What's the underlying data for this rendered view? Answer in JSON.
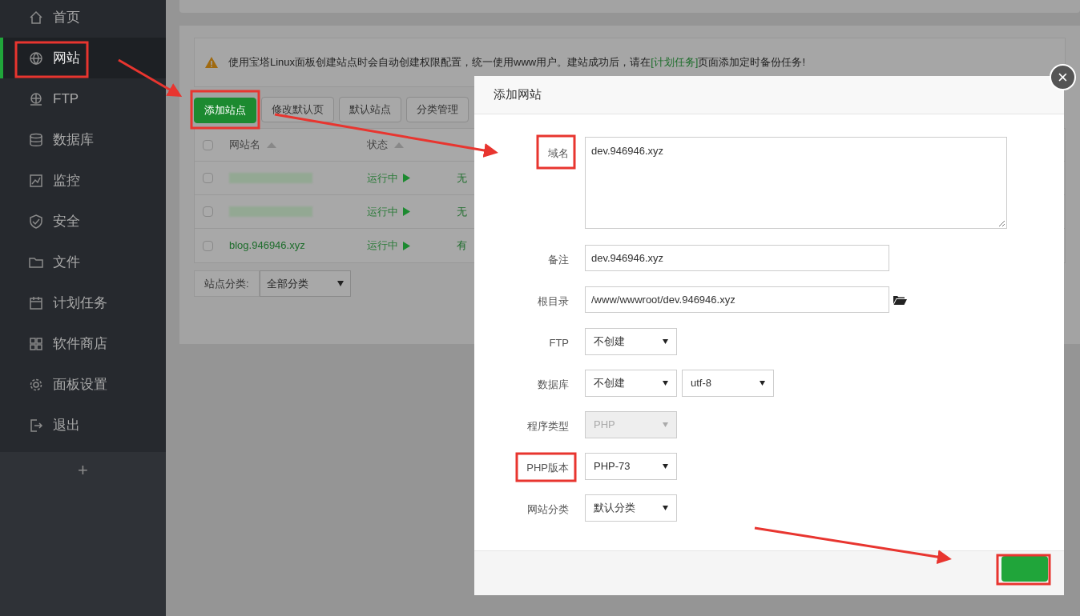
{
  "sidebar": {
    "items": [
      {
        "label": "首页",
        "selected": false
      },
      {
        "label": "网站",
        "selected": true
      },
      {
        "label": "FTP",
        "selected": false
      },
      {
        "label": "数据库",
        "selected": false
      },
      {
        "label": "监控",
        "selected": false
      },
      {
        "label": "安全",
        "selected": false
      },
      {
        "label": "文件",
        "selected": false
      },
      {
        "label": "计划任务",
        "selected": false
      },
      {
        "label": "软件商店",
        "selected": false
      },
      {
        "label": "面板设置",
        "selected": false
      },
      {
        "label": "退出",
        "selected": false
      }
    ],
    "add_label": "+"
  },
  "notice": {
    "before": "使用宝塔Linux面板创建站点时会自动创建权限配置，统一使用www用户。建站成功后，请在",
    "link": "[计划任务]",
    "after": "页面添加定时备份任务!"
  },
  "toolbar": [
    {
      "label": "添加站点",
      "primary": true
    },
    {
      "label": "修改默认页",
      "primary": false
    },
    {
      "label": "默认站点",
      "primary": false
    },
    {
      "label": "分类管理",
      "primary": false
    }
  ],
  "table": {
    "header_checked": false,
    "columns": [
      "网站名",
      "状态"
    ],
    "rows": [
      {
        "checked": false,
        "name": null,
        "status": "运行中",
        "backup": "无"
      },
      {
        "checked": false,
        "name": null,
        "status": "运行中",
        "backup": "无"
      },
      {
        "checked": false,
        "name": "blog.946946.xyz",
        "status": "运行中",
        "backup": "有"
      }
    ]
  },
  "category_filter": {
    "label": "站点分类:",
    "value": "全部分类"
  },
  "dialog": {
    "title": "添加网站",
    "close": "×",
    "fields": [
      {
        "kind": "textarea",
        "label": "域名",
        "value": "dev.946946.xyz"
      },
      {
        "kind": "input",
        "label": "备注",
        "value": "dev.946946.xyz"
      },
      {
        "kind": "folder",
        "label": "根目录",
        "value": "/www/wwwroot/dev.946946.xyz"
      },
      {
        "kind": "select",
        "label": "FTP",
        "value": "不创建"
      },
      {
        "kind": "select_pair",
        "label": "数据库",
        "value": "不创建",
        "value2": "utf-8"
      },
      {
        "kind": "select",
        "label": "程序类型",
        "value": "PHP",
        "disabled": true
      },
      {
        "kind": "select",
        "label": "PHP版本",
        "value": "PHP-73"
      },
      {
        "kind": "select",
        "label": "网站分类",
        "value": "默认分类"
      }
    ]
  }
}
